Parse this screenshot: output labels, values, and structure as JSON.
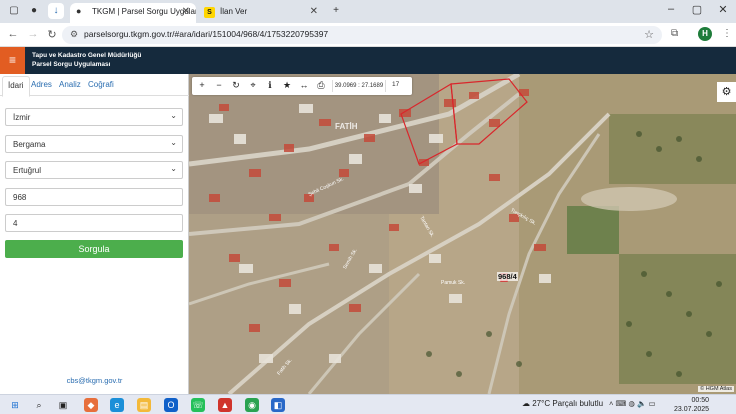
{
  "browser": {
    "tabs": [
      {
        "title": "TKGM | Parsel Sorgu Uygulaması"
      },
      {
        "title": "İlan Ver"
      }
    ],
    "url": "parselsorgu.tkgm.gov.tr/#ara/idari/151004/968/4/1753220795397",
    "profile_initial": "H",
    "new_tab_icon": "+"
  },
  "app": {
    "title_line1": "Tapu ve Kadastro Genel Müdürlüğü",
    "title_line2": "Parsel Sorgu Uygulaması",
    "menu_icon": "≡"
  },
  "panel": {
    "tabs": [
      "İdari",
      "Adres",
      "Analiz",
      "Coğrafi"
    ],
    "province": "İzmir",
    "district": "Bergama",
    "neighborhood": "Ertuğrul",
    "ada": "968",
    "parsel": "4",
    "submit_label": "Sorgula",
    "contact_email": "cbs@tkgm.gov.tr"
  },
  "map": {
    "coordinates": "39.0969 : 27.1689",
    "zoom_level": "17",
    "parcel_label": "968/4",
    "neighborhood_label": "FATİH",
    "street_labels": [
      "Şehit Coşkun Sk.",
      "Fatih Sk.",
      "Tantan Sk.",
      "Tunçkılıç Sk.",
      "Semih Sk.",
      "Pamuk Sk."
    ],
    "attribution": "© HGM Atlas"
  },
  "taskbar": {
    "weather_temp": "27°C",
    "weather_text": "Parçalı bulutlu",
    "time": "00:50",
    "date": "23.07.2025"
  },
  "colors": {
    "header_bg": "#152a3d",
    "menu_accent": "#e25d22",
    "submit_green": "#4cae4c",
    "parcel_outline": "#d9262b"
  }
}
